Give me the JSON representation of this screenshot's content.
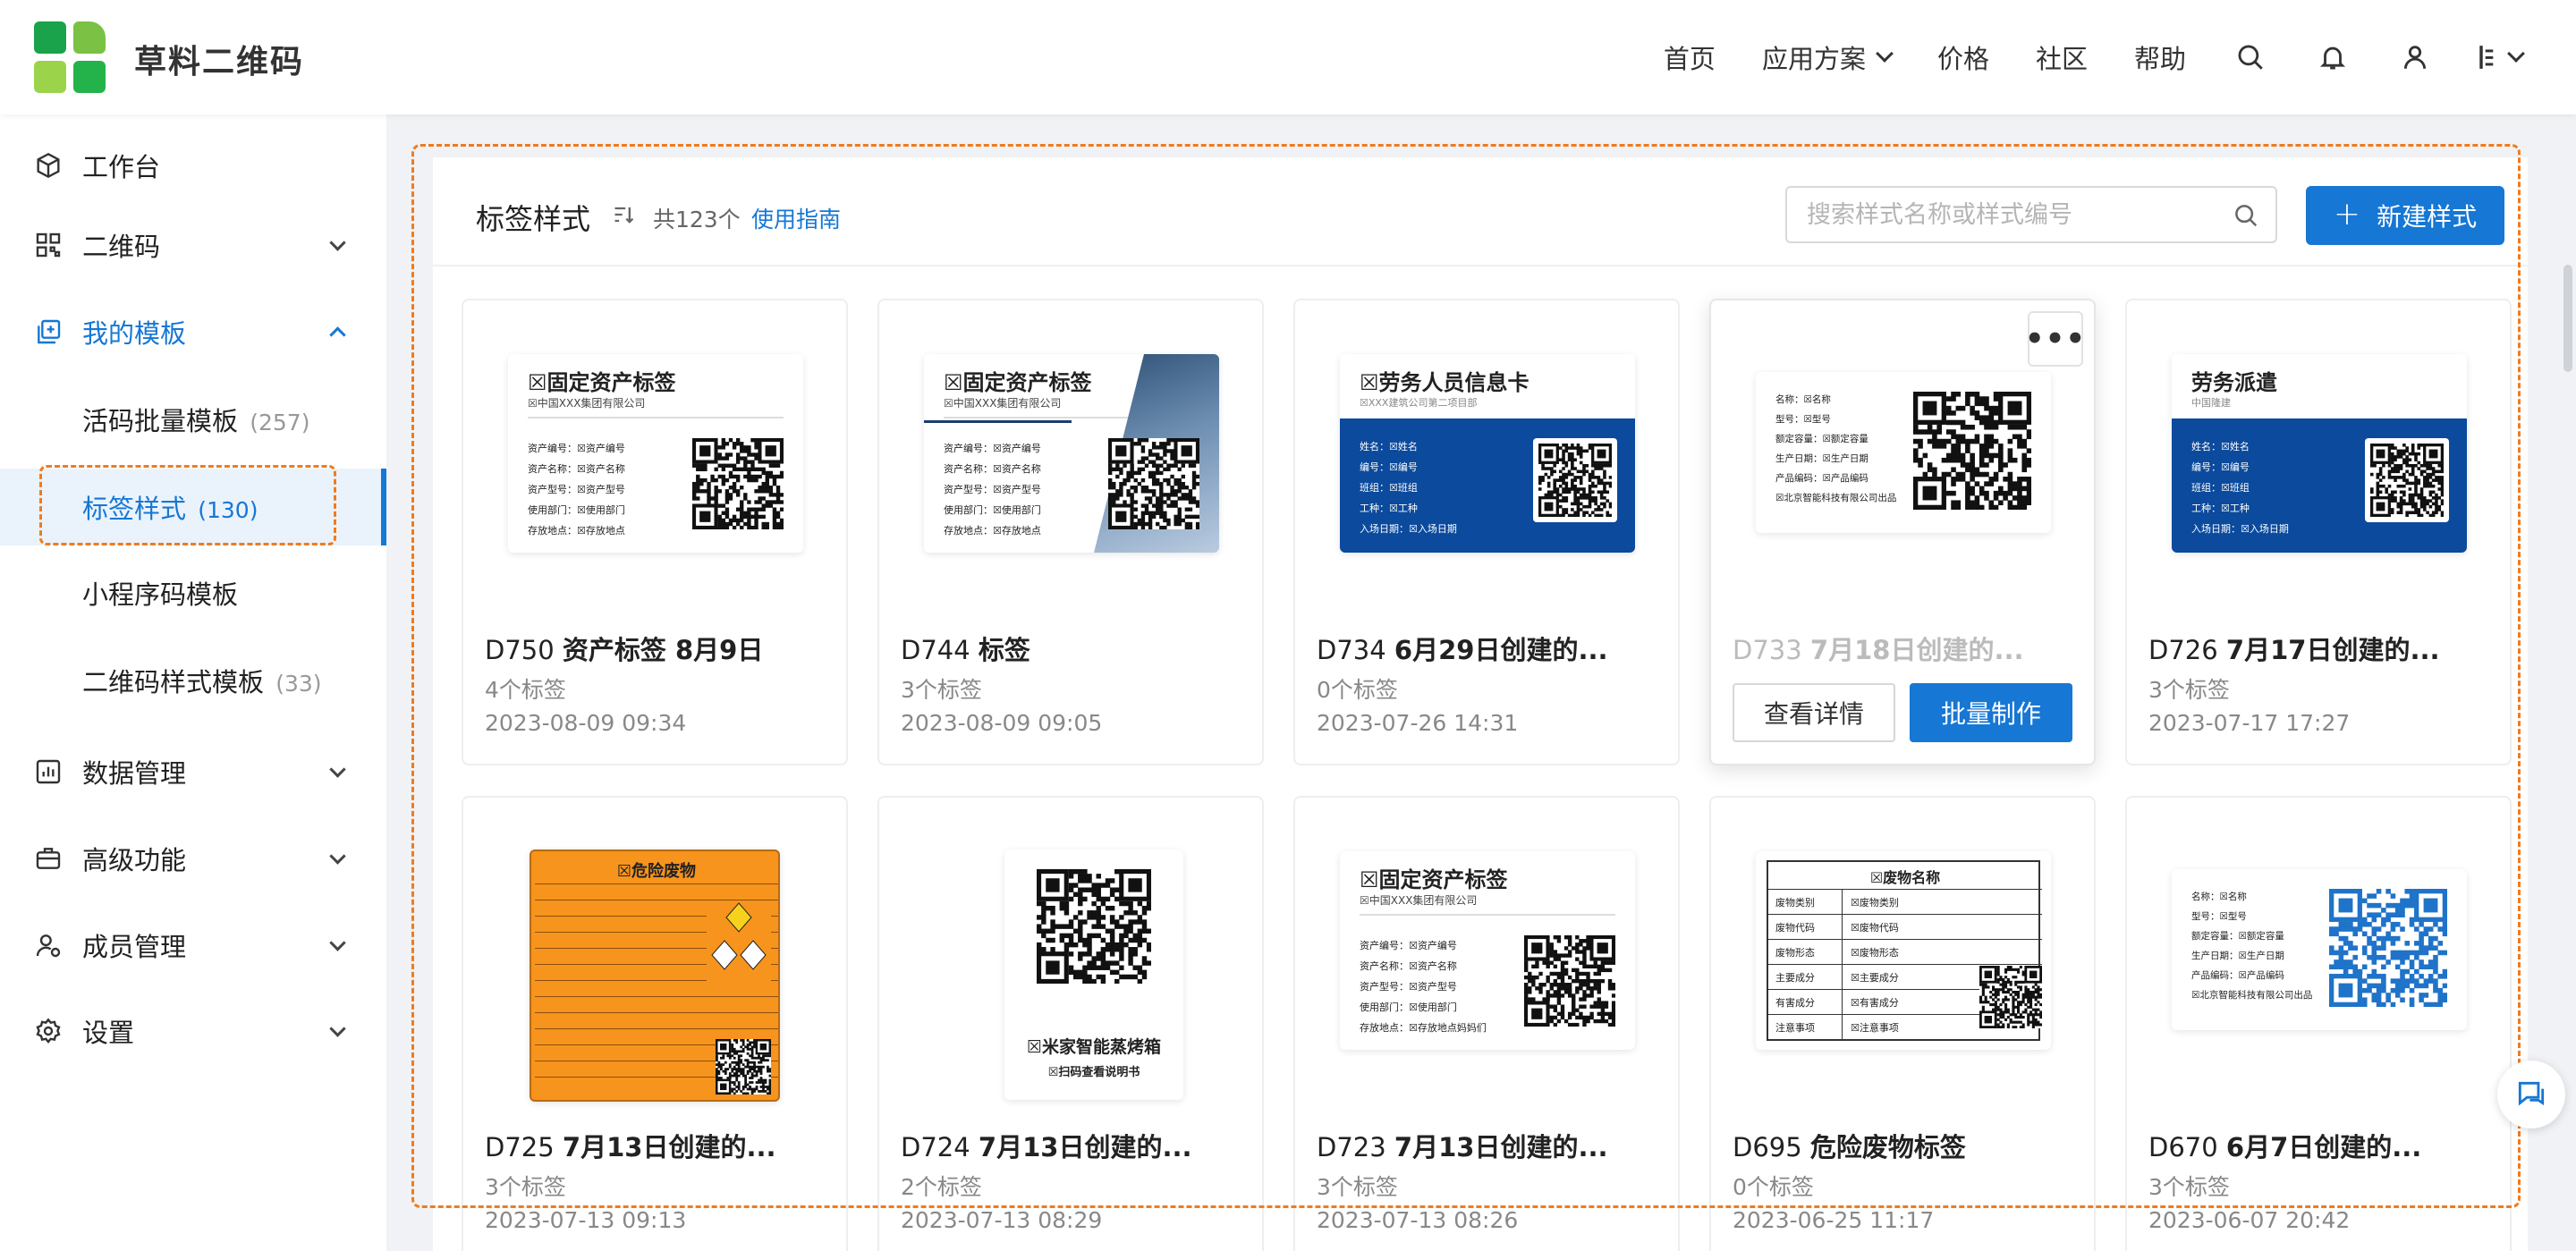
{
  "app": {
    "brand": "草料二维码"
  },
  "colors": {
    "accent": "#1677d4",
    "highlight_dash": "#f07b1e",
    "orange_label": "#f7941d",
    "navy_label": "#0b4a9c"
  },
  "header": {
    "nav": [
      {
        "label": "首页"
      },
      {
        "label": "应用方案",
        "has_dropdown": true
      },
      {
        "label": "价格"
      },
      {
        "label": "社区"
      },
      {
        "label": "帮助"
      }
    ],
    "icons": [
      "search-icon",
      "bell-icon",
      "user-icon",
      "language-icon"
    ]
  },
  "sidebar": {
    "items": [
      {
        "label": "工作台",
        "icon": "cube-icon"
      },
      {
        "label": "二维码",
        "icon": "qr-grid-icon",
        "expandable": true
      },
      {
        "label": "我的模板",
        "icon": "template-icon",
        "expanded": true,
        "active": true
      },
      {
        "label": "数据管理",
        "icon": "chart-icon",
        "expandable": true
      },
      {
        "label": "高级功能",
        "icon": "briefcase-icon",
        "expandable": true
      },
      {
        "label": "成员管理",
        "icon": "member-icon",
        "expandable": true
      },
      {
        "label": "设置",
        "icon": "gear-icon",
        "expandable": true
      }
    ],
    "subitems": [
      {
        "label": "活码批量模板",
        "count": "(257)"
      },
      {
        "label": "标签样式",
        "count": "(130)",
        "selected": true
      },
      {
        "label": "小程序码模板",
        "count": ""
      },
      {
        "label": "二维码样式模板",
        "count": "(33)"
      }
    ]
  },
  "toolbar": {
    "title": "标签样式",
    "count": "共123个",
    "guide": "使用指南",
    "search_placeholder": "搜索样式名称或样式编号",
    "new_button": "新建样式"
  },
  "cards": [
    {
      "code": "D750",
      "title": "资产标签 8月9日",
      "labels": "4个标签",
      "date": "2023-08-09 09:34",
      "thumb": {
        "kind": "asset",
        "title": "☒固定资产标签",
        "company": "☒中国XXX集团有限公司",
        "rows": [
          "资产编号：☒资产编号",
          "资产名称：☒资产名称",
          "资产型号：☒资产型号",
          "使用部门：☒使用部门",
          "存放地点：☒存放地点"
        ]
      }
    },
    {
      "code": "D744",
      "title": "标签",
      "labels": "3个标签",
      "date": "2023-08-09 09:05",
      "thumb": {
        "kind": "asset-photo",
        "title": "☒固定资产标签",
        "company": "☒中国XXX集团有限公司",
        "rows": [
          "资产编号：☒资产编号",
          "资产名称：☒资产名称",
          "资产型号：☒资产型号",
          "使用部门：☒使用部门",
          "存放地点：☒存放地点"
        ]
      }
    },
    {
      "code": "D734",
      "title": "6月29日创建的...",
      "labels": "0个标签",
      "date": "2023-07-26 14:31",
      "thumb": {
        "kind": "navy",
        "title": "☒劳务人员信息卡",
        "company": "☒XXX建筑公司第二项目部",
        "rows": [
          "姓名：☒姓名",
          "编号：☒编号",
          "班组：☒班组",
          "工种：☒工种",
          "入场日期：☒入场日期"
        ]
      }
    },
    {
      "code": "D733",
      "title": "7月18日创建的...",
      "labels": "",
      "date": "",
      "hover": true,
      "more": "•••",
      "btn_detail": "查看详情",
      "btn_batch": "批量制作",
      "thumb": {
        "kind": "product",
        "rows": [
          "名称：☒名称",
          "型号：☒型号",
          "额定容量：☒额定容量",
          "生产日期：☒生产日期",
          "产品编码：☒产品编码",
          "☒北京智能科技有限公司出品"
        ]
      }
    },
    {
      "code": "D726",
      "title": "7月17日创建的...",
      "labels": "3个标签",
      "date": "2023-07-17 17:27",
      "thumb": {
        "kind": "navy2",
        "title": "劳务派遣",
        "company": "中国隆建",
        "rows": [
          "姓名：☒姓名",
          "编号：☒编号",
          "班组：☒班组",
          "工种：☒工种",
          "入场日期：☒入场日期"
        ]
      }
    },
    {
      "code": "D725",
      "title": "7月13日创建的...",
      "labels": "3个标签",
      "date": "2023-07-13 09:13",
      "thumb": {
        "kind": "hazard",
        "title": "☒危险废物"
      }
    },
    {
      "code": "D724",
      "title": "7月13日创建的...",
      "labels": "2个标签",
      "date": "2023-07-13 08:29",
      "thumb": {
        "kind": "bigqr",
        "title": "☒米家智能蒸烤箱",
        "company": "☒扫码查看说明书"
      }
    },
    {
      "code": "D723",
      "title": "7月13日创建的...",
      "labels": "3个标签",
      "date": "2023-07-13 08:26",
      "thumb": {
        "kind": "asset",
        "title": "☒固定资产标签",
        "company": "☒中国XXX集团有限公司",
        "rows": [
          "资产编号：☒资产编号",
          "资产名称：☒资产名称",
          "资产型号：☒资产型号",
          "使用部门：☒使用部门",
          "存放地点：☒存放地点妈妈们"
        ]
      }
    },
    {
      "code": "D695",
      "title": "危险废物标签",
      "labels": "0个标签",
      "date": "2023-06-25 11:17",
      "thumb": {
        "kind": "table",
        "title": "☒废物名称",
        "rows": [
          "废物类别|☒废物类别",
          "废物代码|☒废物代码",
          "废物形态|☒废物形态",
          "主要成分|☒主要成分",
          "有害成分|☒有害成分",
          "注意事项|☒注意事项"
        ]
      }
    },
    {
      "code": "D670",
      "title": "6月7日创建的...",
      "labels": "3个标签",
      "date": "2023-06-07 20:42",
      "thumb": {
        "kind": "product-blue",
        "rows": [
          "名称：☒名称",
          "型号：☒型号",
          "额定容量：☒额定容量",
          "生产日期：☒生产日期",
          "产品编码：☒产品编码",
          "☒北京智能科技有限公司出品"
        ]
      }
    }
  ]
}
